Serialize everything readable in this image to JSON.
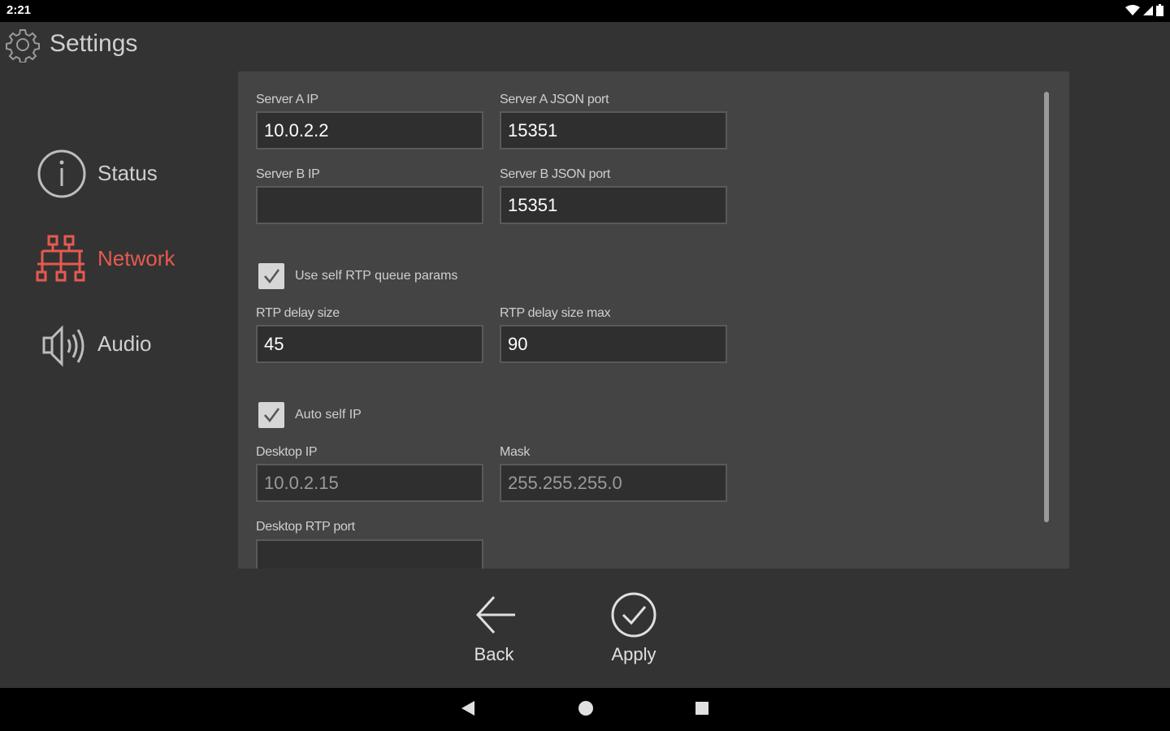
{
  "statusbar": {
    "time": "2:21"
  },
  "header": {
    "title": "Settings"
  },
  "nav": {
    "items": [
      {
        "label": "Status",
        "icon": "info-icon"
      },
      {
        "label": "Network",
        "icon": "network-icon",
        "active": true
      },
      {
        "label": "Audio",
        "icon": "speaker-icon"
      }
    ],
    "active_color": "#e65a50"
  },
  "form": {
    "server_a_ip": {
      "label": "Server A IP",
      "value": "10.0.2.2"
    },
    "server_a_port": {
      "label": "Server A JSON port",
      "value": "15351"
    },
    "server_b_ip": {
      "label": "Server B IP",
      "value": ""
    },
    "server_b_port": {
      "label": "Server B JSON port",
      "value": "15351"
    },
    "use_self_rtp": {
      "label": "Use self RTP queue params",
      "checked": true
    },
    "rtp_delay_size": {
      "label": "RTP delay size",
      "value": "45"
    },
    "rtp_delay_size_max": {
      "label": "RTP delay size max",
      "value": "90"
    },
    "auto_self_ip": {
      "label": "Auto self IP",
      "checked": true
    },
    "desktop_ip": {
      "label": "Desktop IP",
      "value": "10.0.2.15"
    },
    "mask": {
      "label": "Mask",
      "value": "255.255.255.0"
    },
    "desktop_rtp_port": {
      "label": "Desktop RTP port",
      "value": ""
    }
  },
  "actions": {
    "back_label": "Back",
    "apply_label": "Apply"
  }
}
